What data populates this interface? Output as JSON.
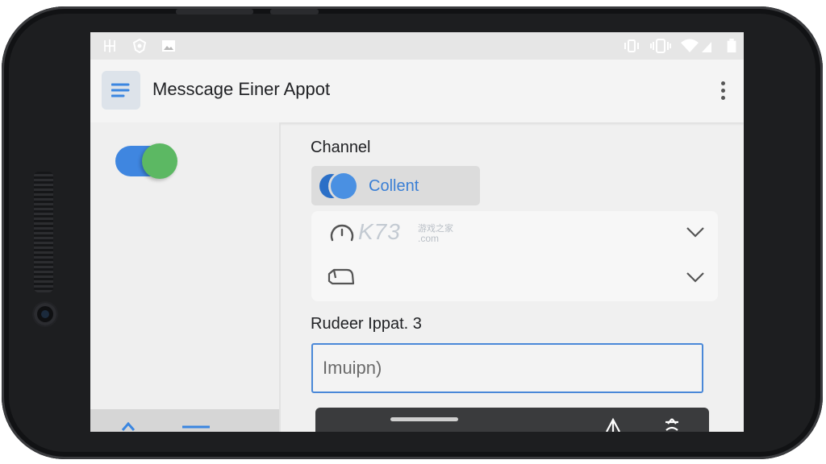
{
  "app_bar": {
    "title": "Messcage Einer Appot"
  },
  "main": {
    "channel_label": "Channel",
    "channel_chip_text": "Collent",
    "field_label": "Rudeer  Ippat. 3",
    "input_value": "Imuipn)"
  },
  "watermark": {
    "brand": "K73",
    "cn": "游戏之家",
    "domain": ".com"
  },
  "colors": {
    "accent_blue": "#3f86e0",
    "toggle_green": "#5cb863"
  }
}
